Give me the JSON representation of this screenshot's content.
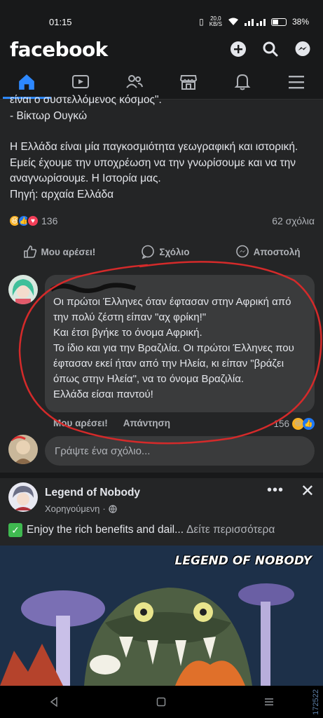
{
  "status": {
    "time": "01:15",
    "net_speed_top": "20,0",
    "net_speed_bottom": "KB/S",
    "battery": "38%"
  },
  "header": {
    "logo": "facebook",
    "icons": [
      "add-icon",
      "search-icon",
      "messenger-icon"
    ]
  },
  "nav": {
    "tabs": [
      "home-icon",
      "watch-icon",
      "friends-icon",
      "marketplace-icon",
      "notifications-icon",
      "menu-icon"
    ],
    "active": "home-icon"
  },
  "post": {
    "quote_line1": "είναι ο συστελλόμενος κόσμος\".",
    "quote_line2": "- Βίκτωρ Ουγκώ",
    "body": "Η Ελλάδα είναι μία παγκοσμιότητα γεωγραφική και ιστορική. Εμείς έχουμε την υποχρέωση να την γνωρίσουμε και να την αναγνωρίσουμε. Η Ιστορία μας.\nΠηγή: αρχαία Ελλάδα",
    "reaction_count": "136",
    "comment_count": "62 σχόλια",
    "actions": {
      "like": "Μου αρέσει!",
      "comment": "Σχόλιο",
      "share": "Αποστολή"
    }
  },
  "comment": {
    "text": "Οι πρώτοι Έλληνες όταν έφτασαν στην Αφρική από την πολύ ζέστη είπαν \"αχ φρίκη!\"\nΚαι  έτσι βγήκε το όνομα Αφρική.\nΤο ίδιο και για την Βραζιλία. Οι πρώτοι Έλληνες που έφτασαν εκεί ήταν από την Ηλεία, κι είπαν \"βράζει όπως στην Ηλεία\", να το όνομα Βραζιλία.\nΕλλάδα είσαι παντού!",
    "like": "Μου αρέσει!",
    "reply": "Απάντηση",
    "reaction_count": "156"
  },
  "write_comment": {
    "placeholder": "Γράψτε ένα σχόλιο..."
  },
  "ad": {
    "name": "Legend of Nobody",
    "sponsored": "Χορηγούμενη",
    "more": "•••",
    "close": "✕",
    "description": "Enjoy the rich benefits and dail...",
    "see_more": "Δείτε περισσότερα",
    "image_logo": "LEGEND OF NOBODY"
  },
  "watermark": "172522",
  "colors": {
    "background": "#18191a",
    "card": "#242526",
    "bubble": "#3a3b3c",
    "accent": "#2d88ff",
    "annotation": "#d42a2a"
  }
}
